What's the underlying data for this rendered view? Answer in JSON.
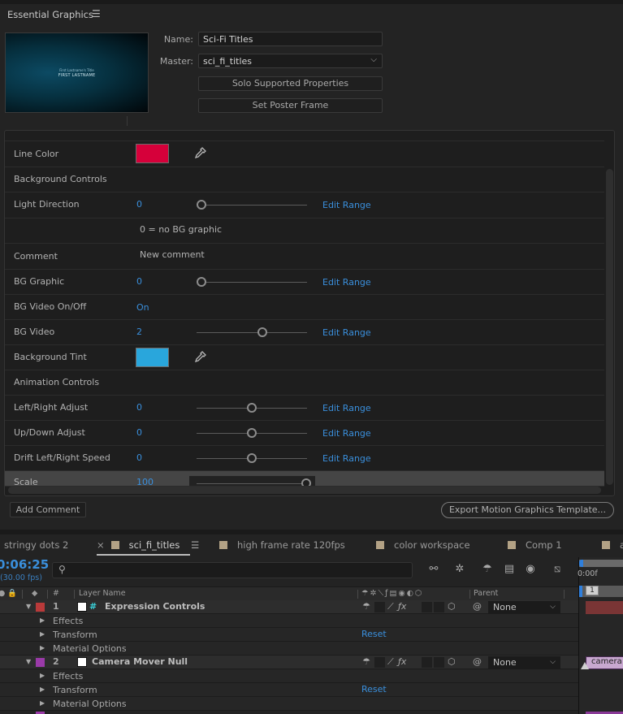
{
  "panel": {
    "title": "Essential Graphics",
    "menu_icon": "hamburger-icon",
    "thumbnail": {
      "line1": "First Lastname's Title",
      "line2": "FIRST LASTNAME"
    },
    "name_label": "Name:",
    "name_value": "Sci-Fi Titles",
    "master_label": "Master:",
    "master_value": "sci_fi_titles",
    "solo_button": "Solo Supported Properties",
    "poster_button": "Set Poster Frame"
  },
  "properties": [
    {
      "name": "Line Color",
      "type": "color",
      "color": "#d6003a"
    },
    {
      "name": "Background Controls",
      "type": "group"
    },
    {
      "name": "Light Direction",
      "type": "slider",
      "value": "0",
      "slider_position": 0.0,
      "edit": "Edit Range"
    },
    {
      "name": "",
      "type": "comment-text",
      "text": "0 = no BG graphic"
    },
    {
      "name": "Comment",
      "type": "comment-text",
      "text": "New comment"
    },
    {
      "name": "BG Graphic",
      "type": "slider",
      "value": "0",
      "slider_position": 0.0,
      "edit": "Edit Range"
    },
    {
      "name": "BG Video On/Off",
      "type": "checkbox",
      "value": "On"
    },
    {
      "name": "BG Video",
      "type": "slider",
      "value": "2",
      "slider_position": 0.6,
      "edit": "Edit Range"
    },
    {
      "name": "Background Tint",
      "type": "color",
      "color": "#29a6dc"
    },
    {
      "name": "Animation Controls",
      "type": "group"
    },
    {
      "name": "Left/Right Adjust",
      "type": "slider",
      "value": "0",
      "slider_position": 0.5,
      "edit": "Edit Range"
    },
    {
      "name": "Up/Down Adjust",
      "type": "slider",
      "value": "0",
      "slider_position": 0.5,
      "edit": "Edit Range"
    },
    {
      "name": "Drift Left/Right Speed",
      "type": "slider",
      "value": "0",
      "slider_position": 0.5,
      "edit": "Edit Range"
    },
    {
      "name": "Scale",
      "type": "slider",
      "value": "100",
      "slider_position": 1.0,
      "edit": ""
    }
  ],
  "footer": {
    "add_comment": "Add Comment",
    "export": "Export Motion Graphics Template..."
  },
  "timeline": {
    "tabs": [
      {
        "label": "stringy dots 2",
        "color": ""
      },
      {
        "label": "sci_fi_titles",
        "color": "#b3a285",
        "active": true,
        "close": "×",
        "menu": "☰"
      },
      {
        "label": "high frame rate 120fps",
        "color": "#b3a285"
      },
      {
        "label": "color workspace",
        "color": "#b3a285"
      },
      {
        "label": "Comp 1",
        "color": "#b3a285"
      },
      {
        "label": "a",
        "color": "#b3a285"
      }
    ],
    "timecode": "0:06:25",
    "fps": "(30.00 fps)",
    "search_placeholder": "",
    "columns": {
      "num": "#",
      "layer_name": "Layer Name",
      "parent": "Parent"
    },
    "ruler": {
      "time": "0:00f",
      "marker": "1"
    },
    "layers": [
      {
        "index": "1",
        "name": "Expression Controls",
        "label_color": "#b93a3a",
        "type_icon": "#",
        "parent": "None",
        "bar_color": "#7a3535",
        "children": [
          {
            "name": "Effects"
          },
          {
            "name": "Transform",
            "reset": "Reset"
          },
          {
            "name": "Material Options"
          }
        ]
      },
      {
        "index": "2",
        "name": "Camera Mover Null",
        "label_color": "#9a3aa8",
        "type_icon": "",
        "parent": "None",
        "bar_color": "#c8a8d0",
        "bar_label": "camera ju",
        "children": [
          {
            "name": "Effects"
          },
          {
            "name": "Transform",
            "reset": "Reset"
          },
          {
            "name": "Material Options"
          }
        ]
      }
    ]
  }
}
